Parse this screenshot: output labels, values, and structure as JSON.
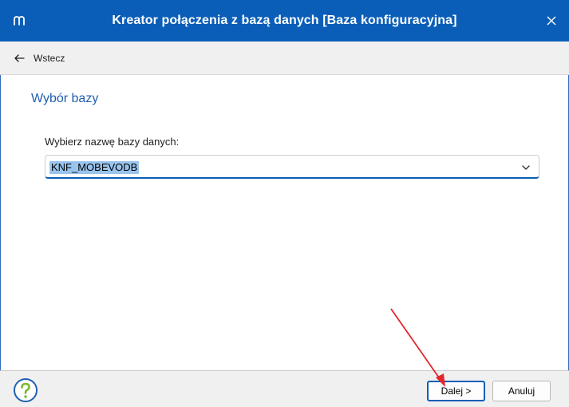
{
  "window": {
    "title": "Kreator połączenia z bazą danych [Baza konfiguracyjna]",
    "accent_color": "#0a5eb8"
  },
  "toolbar": {
    "back_label": "Wstecz",
    "back_icon": "arrow-left-icon"
  },
  "page": {
    "section_title": "Wybór bazy",
    "field_label": "Wybierz nazwę bazy danych:",
    "database_select": {
      "selected_value": "KNF_MOBEVODB"
    }
  },
  "footer": {
    "help_icon": "question-mark-icon",
    "next_label": "Dalej >",
    "cancel_label": "Anuluj"
  },
  "annotation": {
    "arrow_color": "#e3262b"
  }
}
